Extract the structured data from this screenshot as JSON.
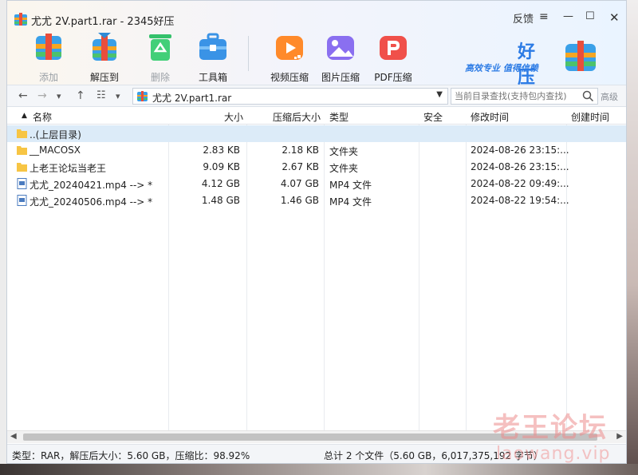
{
  "window": {
    "title": "尤尤 2V.part1.rar - 2345好压",
    "feedback": "反馈",
    "menu_glyph": "≡",
    "min_glyph": "—",
    "max_glyph": "☐",
    "close_glyph": "✕"
  },
  "toolbar": {
    "add": "添加",
    "extract": "解压到",
    "delete": "删除",
    "tools": "工具箱",
    "video": "视频压缩",
    "image": "图片压缩",
    "pdf": "PDF压缩"
  },
  "brand": {
    "name": "好压",
    "slogan": "高效专业  值得信赖"
  },
  "address": {
    "path": "尤尤 2V.part1.rar",
    "search_placeholder": "当前目录查找(支持包内查找)",
    "advanced": "高级"
  },
  "columns": {
    "name": "名称",
    "size": "大小",
    "packed": "压缩后大小",
    "type": "类型",
    "security": "安全",
    "modified": "修改时间",
    "created": "创建时间"
  },
  "rows": [
    {
      "name": "..(上层目录)",
      "size": "",
      "packed": "",
      "type": "",
      "modified": "",
      "icon": "folder-icon"
    },
    {
      "name": "__MACOSX",
      "size": "2.83 KB",
      "packed": "2.18 KB",
      "type": "文件夹",
      "modified": "2024-08-26 23:15:...",
      "icon": "folder-icon"
    },
    {
      "name": "上老王论坛当老王",
      "size": "9.09 KB",
      "packed": "2.67 KB",
      "type": "文件夹",
      "modified": "2024-08-26 23:15:...",
      "icon": "folder-icon"
    },
    {
      "name": "尤尤_20240421.mp4 --> *",
      "size": "4.12 GB",
      "packed": "4.07 GB",
      "type": "MP4 文件",
      "modified": "2024-08-22 09:49:...",
      "icon": "video-file-icon"
    },
    {
      "name": "尤尤_20240506.mp4 --> *",
      "size": "1.48 GB",
      "packed": "1.46 GB",
      "type": "MP4 文件",
      "modified": "2024-08-22 19:54:...",
      "icon": "video-file-icon"
    }
  ],
  "status": {
    "left": "类型：RAR，解压后大小：5.60 GB，压缩比：98.92%",
    "right": "总计 2 个文件（5.60 GB，6,017,375,192 字节）"
  },
  "watermark": {
    "line1": "老王论坛",
    "line2": "laowang.vip"
  },
  "colors": {
    "accent": "#2c7be5",
    "selected_row": "#dcebf8"
  }
}
